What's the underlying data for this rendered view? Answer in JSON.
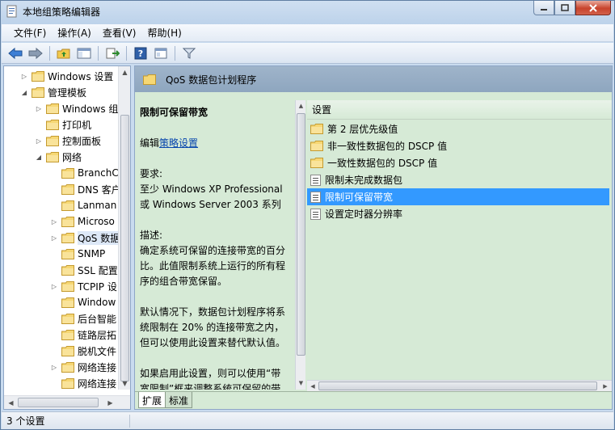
{
  "window": {
    "title": "本地组策略编辑器"
  },
  "menu": [
    "文件(F)",
    "操作(A)",
    "查看(V)",
    "帮助(H)"
  ],
  "toolbar": {
    "icons": [
      "back-icon",
      "forward-icon",
      "up-folder-icon",
      "show-hide-tree-icon",
      "export-list-icon",
      "help-icon",
      "properties-icon",
      "filter-icon"
    ]
  },
  "tree": [
    {
      "label": "Windows 设置",
      "level": 1,
      "expander": "collapsed"
    },
    {
      "label": "管理模板",
      "level": 1,
      "expander": "expanded"
    },
    {
      "label": "Windows 组",
      "level": 2,
      "expander": "collapsed"
    },
    {
      "label": "打印机",
      "level": 2,
      "expander": "none"
    },
    {
      "label": "控制面板",
      "level": 2,
      "expander": "collapsed"
    },
    {
      "label": "网络",
      "level": 2,
      "expander": "expanded"
    },
    {
      "label": "BranchC",
      "level": 3,
      "expander": "none"
    },
    {
      "label": "DNS 客户",
      "level": 3,
      "expander": "none"
    },
    {
      "label": "Lanman",
      "level": 3,
      "expander": "none"
    },
    {
      "label": "Microso",
      "level": 3,
      "expander": "collapsed"
    },
    {
      "label": "QoS 数据",
      "level": 3,
      "expander": "collapsed",
      "selected": true
    },
    {
      "label": "SNMP",
      "level": 3,
      "expander": "none"
    },
    {
      "label": "SSL 配置",
      "level": 3,
      "expander": "none"
    },
    {
      "label": "TCPIP 设",
      "level": 3,
      "expander": "collapsed"
    },
    {
      "label": "Window",
      "level": 3,
      "expander": "none"
    },
    {
      "label": "后台智能",
      "level": 3,
      "expander": "none"
    },
    {
      "label": "链路层拓",
      "level": 3,
      "expander": "none"
    },
    {
      "label": "脱机文件",
      "level": 3,
      "expander": "none"
    },
    {
      "label": "网络连接",
      "level": 3,
      "expander": "collapsed"
    },
    {
      "label": "网络连接",
      "level": 3,
      "expander": "none"
    }
  ],
  "right": {
    "header_title": "QoS 数据包计划程序",
    "description": {
      "title": "限制可保留带宽",
      "edit_prefix": "编辑",
      "edit_link": "策略设置",
      "requirements_label": "要求:",
      "requirements_text": "至少 Windows XP Professional 或 Windows Server 2003 系列",
      "desc_label": "描述:",
      "desc_text": "确定系统可保留的连接带宽的百分比。此值限制系统上运行的所有程序的组合带宽保留。",
      "default_text": "默认情况下，数据包计划程序将系统限制在 20% 的连接带宽之内，但可以使用此设置来替代默认值。",
      "enabled_text": "如果启用此设置，则可以使用“带宽限制”框来调整系统可保留的带"
    },
    "list_header": "设置",
    "list": [
      {
        "label": "第 2 层优先级值",
        "type": "folder"
      },
      {
        "label": "非一致性数据包的 DSCP 值",
        "type": "folder"
      },
      {
        "label": "一致性数据包的 DSCP 值",
        "type": "folder"
      },
      {
        "label": "限制未完成数据包",
        "type": "setting"
      },
      {
        "label": "限制可保留带宽",
        "type": "setting",
        "selected": true
      },
      {
        "label": "设置定时器分辨率",
        "type": "setting"
      }
    ],
    "tabs": [
      "扩展",
      "标准"
    ],
    "active_tab": "扩展"
  },
  "status": {
    "text": "3 个设置"
  },
  "colors": {
    "selection": "#3399ff",
    "pane_bg": "#d6ead6",
    "link": "#0645ad"
  }
}
